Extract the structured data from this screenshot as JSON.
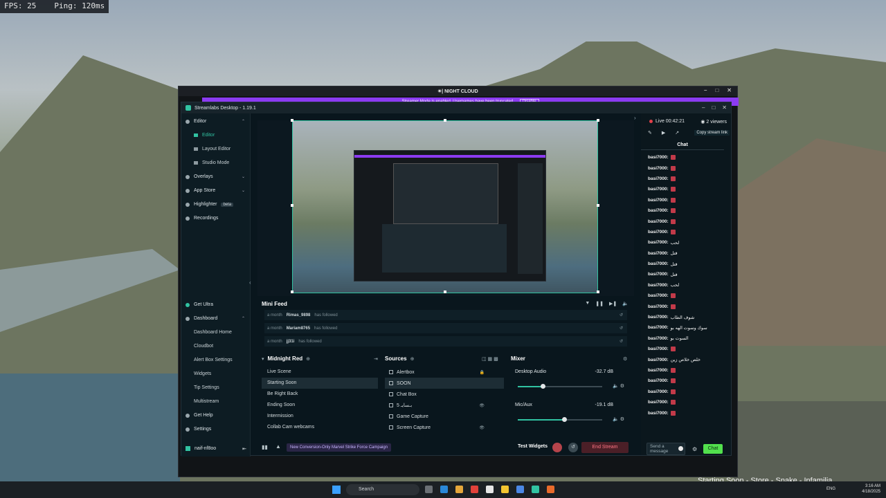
{
  "hud": {
    "fps": "FPS: 25",
    "ping": "Ping: 120ms"
  },
  "outer_window": {
    "title": "✴| NIGHT CLOUD",
    "banner": "Streamer Mode is enabled. Usernames have been truncated.",
    "banner_btn": "Disable"
  },
  "streamlabs": {
    "title": "Streamlabs Desktop - 1.19.1",
    "nav": {
      "editor": "Editor",
      "editor_sub": [
        "Editor",
        "Layout Editor",
        "Studio Mode"
      ],
      "overlays": "Overlays",
      "app_store": "App Store",
      "highlighter": "Highlighter",
      "beta": "beta",
      "recordings": "Recordings",
      "get_ultra": "Get Ultra",
      "dashboard": "Dashboard",
      "dashboard_sub": [
        "Dashboard Home",
        "Cloudbot",
        "Alert Box Settings",
        "Widgets",
        "Tip Settings",
        "Multistream"
      ],
      "get_help": "Get Help",
      "settings": "Settings",
      "user": "naif-nf8oo"
    },
    "mini_feed": {
      "title": "Mini Feed",
      "rows": [
        {
          "time": "a month",
          "name": "Rimas_9898",
          "action": "has followed"
        },
        {
          "time": "a month",
          "name": "Mariam8765",
          "action": "has followed"
        },
        {
          "time": "a month",
          "name": "jj31i",
          "action": "has followed"
        }
      ]
    },
    "scenes": {
      "title": "Midnight Red",
      "items": [
        "Live Scene",
        "Starting Soon",
        "Be Right Back",
        "Ending Soon",
        "Intermission",
        "Collab Cam webcams"
      ]
    },
    "sources": {
      "title": "Sources",
      "items": [
        "Alertbox",
        "SOON",
        "Chat Box",
        "بـسايـ 5",
        "Game Capture",
        "Screen Capture"
      ]
    },
    "mixer": {
      "title": "Mixer",
      "items": [
        {
          "name": "Desktop Audio",
          "db": "-32.7 dB"
        },
        {
          "name": "Mic/Aux",
          "db": "-19.1 dB"
        }
      ]
    },
    "footer": {
      "campaign": "New Conversion-Only Marvel Strike Force Campaign",
      "test_widgets": "Test Widgets",
      "end_stream": "End Stream"
    },
    "right": {
      "live": "Live 00:42:21",
      "viewers": "2 viewers",
      "copy_link": "Copy stream link",
      "chat_tab": "Chat",
      "messages": [
        {
          "user": "basi7000:",
          "text": ""
        },
        {
          "user": "basi7000:",
          "text": ""
        },
        {
          "user": "basi7000:",
          "text": ""
        },
        {
          "user": "basi7000:",
          "text": ""
        },
        {
          "user": "basi7000:",
          "text": ""
        },
        {
          "user": "basi7000:",
          "text": ""
        },
        {
          "user": "basi7000:",
          "text": ""
        },
        {
          "user": "basi7000:",
          "text": ""
        },
        {
          "user": "basi7000:",
          "text": "لحب"
        },
        {
          "user": "basi7000:",
          "text": "فتل"
        },
        {
          "user": "basi7000:",
          "text": "فتل"
        },
        {
          "user": "basi7000:",
          "text": "فتل"
        },
        {
          "user": "basi7000:",
          "text": "لحب"
        },
        {
          "user": "basi7000:",
          "text": ""
        },
        {
          "user": "basi7000:",
          "text": ""
        },
        {
          "user": "basi7000:",
          "text": "شوف الطاب"
        },
        {
          "user": "basi7000:",
          "text": "سوك وسوت الهه بو"
        },
        {
          "user": "basi7000:",
          "text": "السوت بو"
        },
        {
          "user": "basi7000:",
          "text": ""
        },
        {
          "user": "basi7000:",
          "text": "خلص خلاص زين"
        },
        {
          "user": "basi7000:",
          "text": ""
        },
        {
          "user": "basi7000:",
          "text": ""
        },
        {
          "user": "basi7000:",
          "text": ""
        },
        {
          "user": "basi7000:",
          "text": ""
        },
        {
          "user": "basi7000:",
          "text": ""
        }
      ],
      "send_placeholder": "Send a message",
      "chat_button": "Chat"
    }
  },
  "taskbar": {
    "search": "Search",
    "lang": "ENG",
    "time": "3:16 AM",
    "date": "4/18/2025"
  },
  "overlay_text": "Starting Soon - Store - Snake - Infamilia",
  "colors": {
    "accent": "#31c3a2",
    "purple": "#8c3bf2",
    "live_red": "#e3404a",
    "chat_green": "#52e04d"
  }
}
